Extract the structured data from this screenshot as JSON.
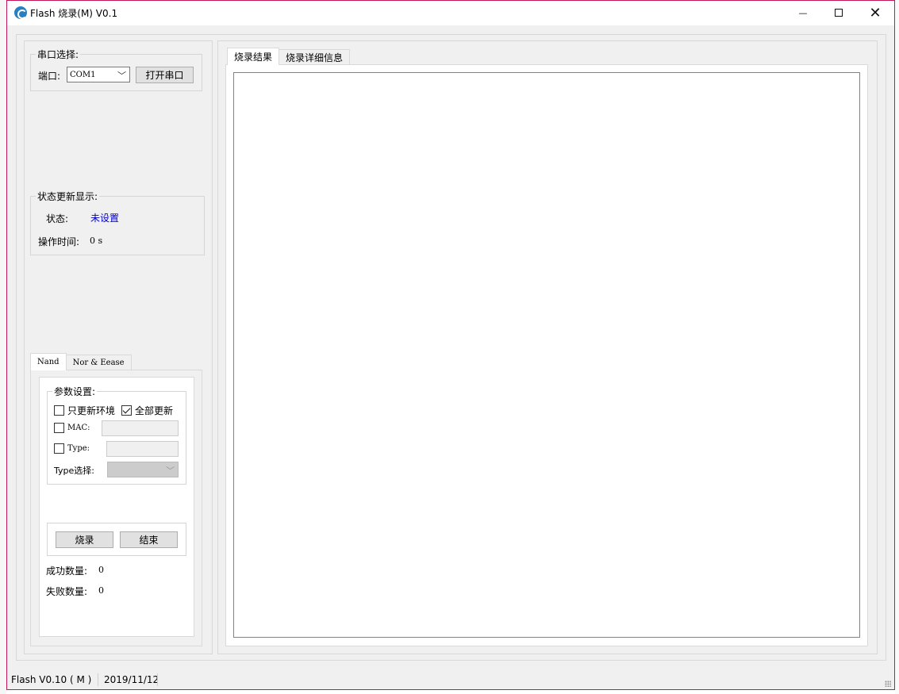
{
  "window": {
    "title": "Flash 烧录(M)  V0.1",
    "close_glyph": "✕",
    "minimize_glyph": "—"
  },
  "serial": {
    "group_label": "串口选择:",
    "port_label": "端口:",
    "port_value": "COM1",
    "open_button": "打开串口"
  },
  "status_group": {
    "group_label": "状态更新显示:",
    "state_label": "状态:",
    "state_value": "未设置",
    "state_color": "#0000cc",
    "time_label": "操作时间:",
    "time_value": "0 s"
  },
  "mode_tabs": [
    {
      "label": "Nand",
      "active": true
    },
    {
      "label": "Nor & Eease",
      "active": false
    }
  ],
  "params": {
    "group_label": "参数设置:",
    "env_only": {
      "label": "只更新环境",
      "checked": false
    },
    "full_update": {
      "label": "全部更新",
      "checked": true
    },
    "mac": {
      "label": "MAC:",
      "checked": false,
      "value": ""
    },
    "type": {
      "label": "Type:",
      "checked": false,
      "value": ""
    },
    "type_select_label": "Type选择:",
    "type_select_value": ""
  },
  "actions": {
    "burn_button": "烧录",
    "stop_button": "结束"
  },
  "counters": {
    "success_label": "成功数量:",
    "success_value": "0",
    "fail_label": "失败数量:",
    "fail_value": "0"
  },
  "result_tabs": [
    {
      "label": "烧录结果",
      "active": true
    },
    {
      "label": "烧录详细信息",
      "active": false
    }
  ],
  "statusbar": {
    "version": "Flash  V0.10 ( M )",
    "date": "2019/11/12"
  },
  "icons": [
    "flash-app-icon",
    "minimize-icon",
    "maximize-icon",
    "close-icon",
    "chevron-down-icon",
    "checkmark-icon",
    "resize-grip-icon"
  ]
}
